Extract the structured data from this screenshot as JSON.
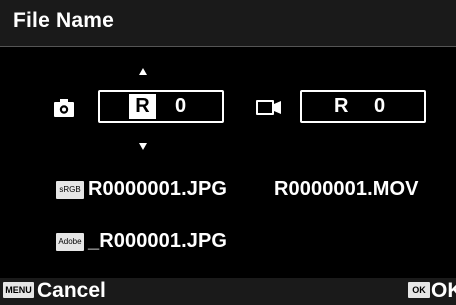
{
  "title": "File Name",
  "photo": {
    "prefix_selected": "R",
    "counter": "0"
  },
  "movie": {
    "prefix": "R",
    "counter": "0"
  },
  "files": {
    "srgb_badge": "sRGB",
    "srgb_name": "R0000001.JPG",
    "mov_name": "R0000001.MOV",
    "adobe_badge": "Adobe",
    "adobe_name": "_R000001.JPG"
  },
  "footer": {
    "menu_badge": "MENU",
    "cancel_label": "Cancel",
    "ok_badge": "OK",
    "ok_label": "OK"
  },
  "icons": {
    "photo": "camera-icon",
    "movie": "movie-camera-icon",
    "up": "arrow-up-icon",
    "down": "arrow-down-icon"
  },
  "colors": {
    "background": "#000000",
    "bar": "#1a1a1a",
    "text": "#ffffff",
    "badge": "#e6e6e6"
  }
}
